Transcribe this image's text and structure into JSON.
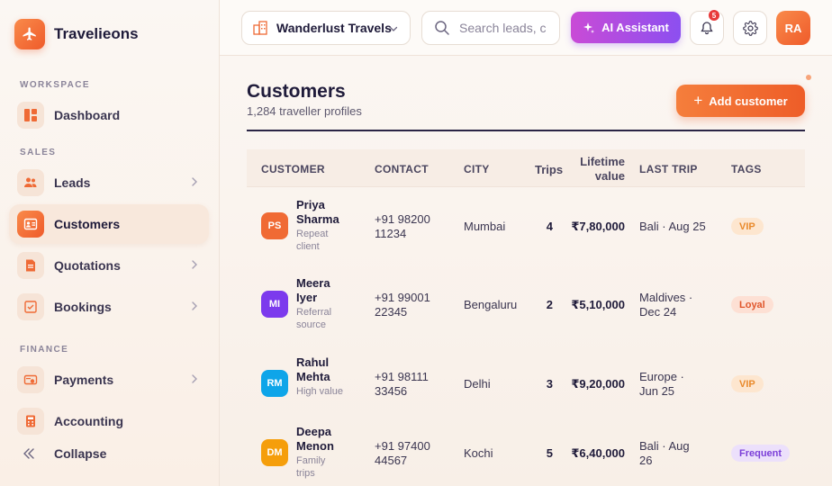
{
  "brand": {
    "name": "Travelieons"
  },
  "sidebar": {
    "sections": {
      "workspace": "WORKSPACE",
      "sales": "SALES",
      "finance": "FINANCE"
    },
    "items": [
      {
        "label": "Dashboard",
        "icon": "dashboard-icon"
      },
      {
        "label": "Leads",
        "icon": "users-icon"
      },
      {
        "label": "Customers",
        "icon": "contact-card-icon",
        "active": true
      },
      {
        "label": "Quotations",
        "icon": "document-icon"
      },
      {
        "label": "Bookings",
        "icon": "checklist-icon"
      },
      {
        "label": "Payments",
        "icon": "payment-icon"
      },
      {
        "label": "Accounting",
        "icon": "calculator-icon"
      }
    ],
    "collapse_label": "Collapse"
  },
  "topbar": {
    "company": "Wanderlust Travels",
    "search_placeholder": "Search leads, c",
    "ai_label": "AI Assistant",
    "notification_count": "5",
    "user_initials": "RA"
  },
  "page": {
    "title": "Customers",
    "subtitle": "1,284 traveller profiles",
    "add_label": "Add customer"
  },
  "table": {
    "headers": {
      "customer": "CUSTOMER",
      "contact": "CONTACT",
      "city": "CITY",
      "trips": "Trips",
      "value_line1": "Lifetime",
      "value_line2": "value",
      "last_trip": "LAST TRIP",
      "tags": "TAGS"
    },
    "rows": [
      {
        "initials": "PS",
        "avatar_color": "#f06a34",
        "name1": "Priya",
        "name2": "Sharma",
        "note1": "Repeat",
        "note2": "client",
        "phone1": "+91 98200",
        "phone2": "11234",
        "city": "Mumbai",
        "trips": "4",
        "value": "₹7,80,000",
        "trip1": "Bali · Aug 25",
        "trip2": "",
        "tag": "VIP",
        "tag_style": "vip"
      },
      {
        "initials": "MI",
        "avatar_color": "#7c3aed",
        "name1": "Meera",
        "name2": "Iyer",
        "note1": "Referral",
        "note2": "source",
        "phone1": "+91 99001",
        "phone2": "22345",
        "city": "Bengaluru",
        "trips": "2",
        "value": "₹5,10,000",
        "trip1": "Maldives ·",
        "trip2": "Dec 24",
        "tag": "Loyal",
        "tag_style": "loyal"
      },
      {
        "initials": "RM",
        "avatar_color": "#0ea5e9",
        "name1": "Rahul",
        "name2": "Mehta",
        "note1": "High value",
        "note2": "",
        "phone1": "+91 98111",
        "phone2": "33456",
        "city": "Delhi",
        "trips": "3",
        "value": "₹9,20,000",
        "trip1": "Europe ·",
        "trip2": "Jun 25",
        "tag": "VIP",
        "tag_style": "vip"
      },
      {
        "initials": "DM",
        "avatar_color": "#f59e0b",
        "name1": "Deepa",
        "name2": "Menon",
        "note1": "Family",
        "note2": "trips",
        "phone1": "+91 97400",
        "phone2": "44567",
        "city": "Kochi",
        "trips": "5",
        "value": "₹6,40,000",
        "trip1": "Bali · Aug",
        "trip2": "26",
        "tag": "Frequent",
        "tag_style": "frequent"
      }
    ]
  }
}
